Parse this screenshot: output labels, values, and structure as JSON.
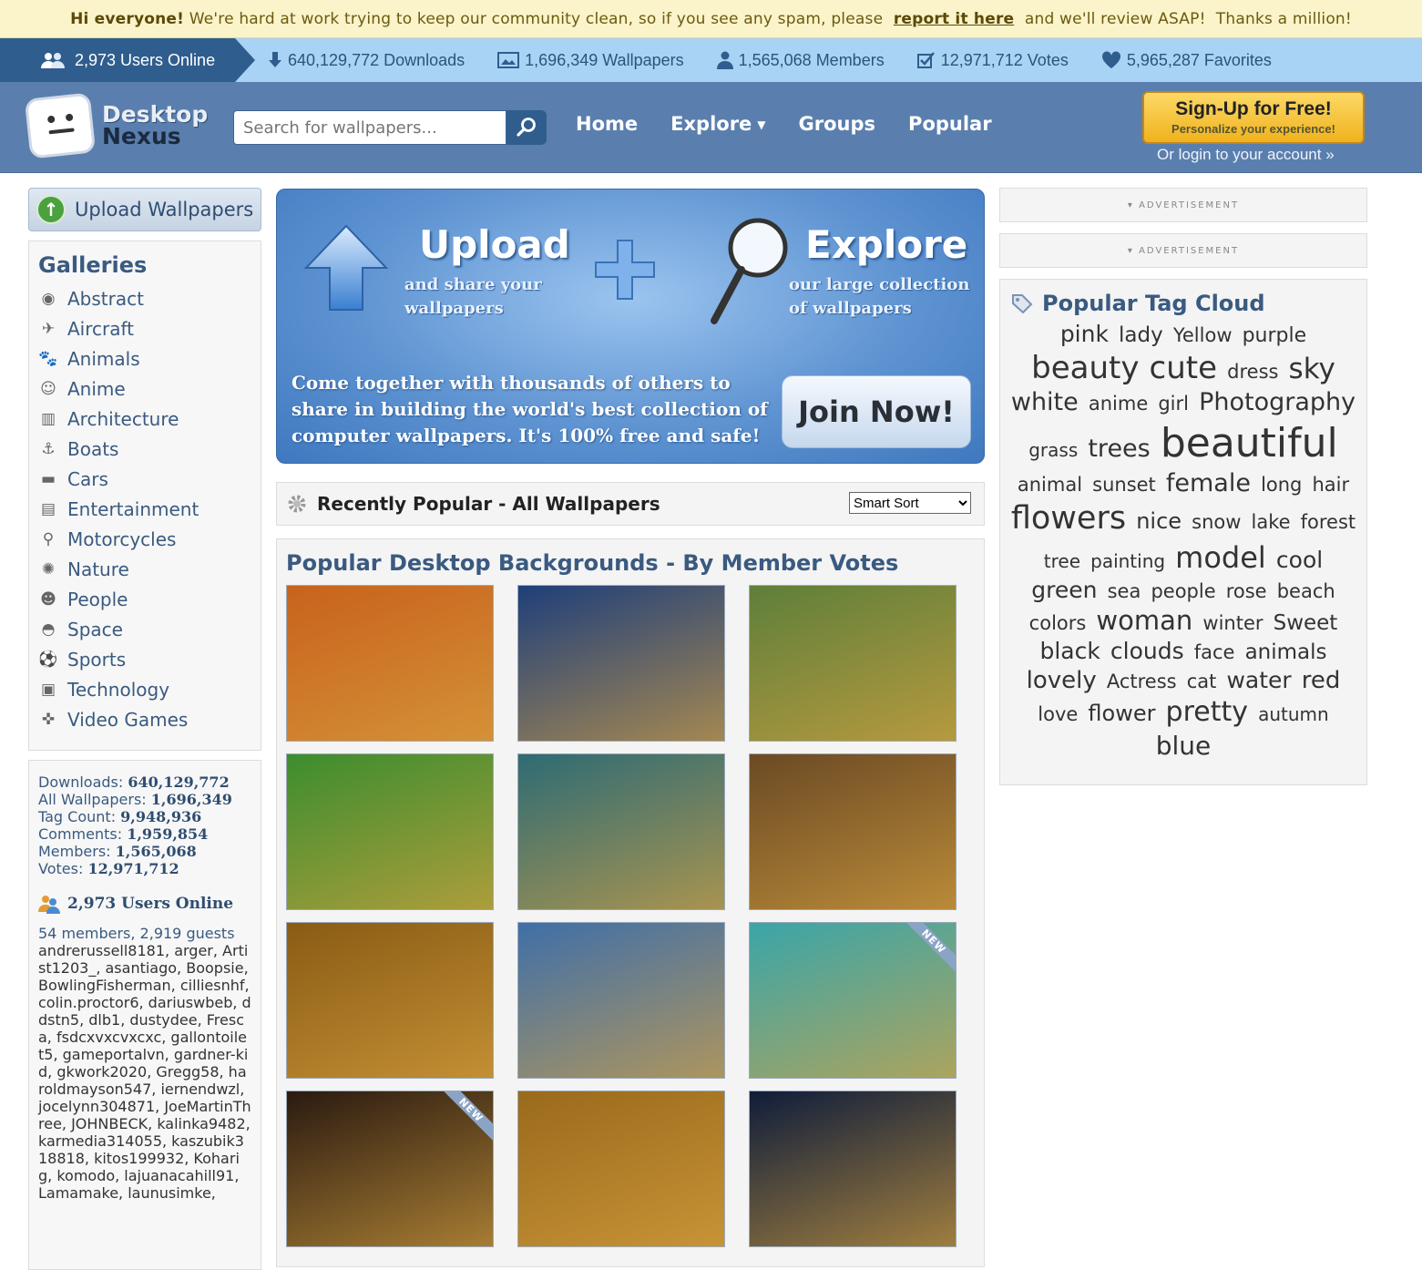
{
  "notice": {
    "greeting": "Hi everyone!",
    "text_before": " We're hard at work trying to keep our community clean, so if you see any spam, please ",
    "link": "report it here",
    "text_after": " and we'll review ASAP!  Thanks a million!"
  },
  "stats": {
    "online": "2,973 Users Online",
    "downloads": "640,129,772 Downloads",
    "wallpapers": "1,696,349 Wallpapers",
    "members": "1,565,068 Members",
    "votes": "12,971,712 Votes",
    "favorites": "5,965,287 Favorites"
  },
  "header": {
    "logo_line1": "Desktop",
    "logo_line2": "Nexus",
    "search_placeholder": "Search for wallpapers...",
    "nav": [
      "Home",
      "Explore",
      "Groups",
      "Popular"
    ],
    "signup_title": "Sign-Up for Free!",
    "signup_sub": "Personalize your experience!",
    "login": "Or login to your account »"
  },
  "left": {
    "upload": "Upload Wallpapers",
    "galleries_title": "Galleries",
    "galleries": [
      {
        "label": "Abstract",
        "icon": "eye-icon",
        "glyph": "◉"
      },
      {
        "label": "Aircraft",
        "icon": "aircraft-icon",
        "glyph": "✈"
      },
      {
        "label": "Animals",
        "icon": "animals-icon",
        "glyph": "🐾"
      },
      {
        "label": "Anime",
        "icon": "anime-icon",
        "glyph": "☺"
      },
      {
        "label": "Architecture",
        "icon": "architecture-icon",
        "glyph": "▥"
      },
      {
        "label": "Boats",
        "icon": "anchor-icon",
        "glyph": "⚓"
      },
      {
        "label": "Cars",
        "icon": "car-icon",
        "glyph": "▬"
      },
      {
        "label": "Entertainment",
        "icon": "film-icon",
        "glyph": "▤"
      },
      {
        "label": "Motorcycles",
        "icon": "motorcycle-icon",
        "glyph": "⚲"
      },
      {
        "label": "Nature",
        "icon": "nature-icon",
        "glyph": "✺"
      },
      {
        "label": "People",
        "icon": "person-icon",
        "glyph": "☻"
      },
      {
        "label": "Space",
        "icon": "ufo-icon",
        "glyph": "◓"
      },
      {
        "label": "Sports",
        "icon": "sports-icon",
        "glyph": "⚽"
      },
      {
        "label": "Technology",
        "icon": "monitor-icon",
        "glyph": "▣"
      },
      {
        "label": "Video Games",
        "icon": "gamepad-icon",
        "glyph": "✜"
      }
    ],
    "site_stats": [
      {
        "label": "Downloads:",
        "value": "640,129,772"
      },
      {
        "label": "All Wallpapers:",
        "value": "1,696,349"
      },
      {
        "label": "Tag Count:",
        "value": "9,948,936"
      },
      {
        "label": "Comments:",
        "value": "1,959,854"
      },
      {
        "label": "Members:",
        "value": "1,565,068"
      },
      {
        "label": "Votes:",
        "value": "12,971,712"
      }
    ],
    "online_head": "2,973 Users Online",
    "member_guest": "54 members, 2,919 guests",
    "online_names": "andrerussell8181, arger, Artist1203_, asantiago, Boopsie, BowlingFisherman, cilliesnhf, colin.proctor6, dariuswbeb, ddstn5, dlb1, dustydee, Fresca, fsdcxvxcvxcxc, gallontoilet5, gameportalvn, gardner-kid, gkwork2020, Gregg58, haroldmayson547, iernendwzl, jocelynn304871, JoeMartinThree, JOHNBECK, kalinka9482, karmedia314055, kaszubik318818, kitos199932, Koharig, komodo, lajuanacahill91, Lamamake, launusimke,"
  },
  "banner": {
    "upload_title": "Upload",
    "upload_sub": "and share your wallpapers",
    "explore_title": "Explore",
    "explore_sub": "our large collection of wallpapers",
    "pitch": "Come together with thousands of others to share in building the world's best collection of computer wallpapers. It's 100% free and safe!",
    "join": "Join Now!"
  },
  "sortbar": {
    "title": "Recently Popular - All Wallpapers",
    "sort_value": "Smart Sort"
  },
  "gallery": {
    "title": "Popular Desktop Backgrounds - By Member Votes",
    "thumbs": [
      {
        "name": "thumb-autumn-pumpkins-basket",
        "bg": "#c8621d",
        "new": false
      },
      {
        "name": "thumb-halloween-witch-night",
        "bg": "#1f3f7a",
        "new": false
      },
      {
        "name": "thumb-mountain-autumn-forest",
        "bg": "#5e7f3a",
        "new": false
      },
      {
        "name": "thumb-trick-or-treat-pumpkin",
        "bg": "#3c8d2e",
        "new": false
      },
      {
        "name": "thumb-lake-reflection",
        "bg": "#2e6b74",
        "new": false
      },
      {
        "name": "thumb-waterfall-autumn",
        "bg": "#6b4a24",
        "new": false
      },
      {
        "name": "thumb-golden-hills",
        "bg": "#8a5b14",
        "new": false
      },
      {
        "name": "thumb-autumn-tree-sky",
        "bg": "#3f6fa8",
        "new": false
      },
      {
        "name": "thumb-coastal-cove",
        "bg": "#3aa5a8",
        "new": true
      },
      {
        "name": "thumb-jack-o-lanterns",
        "bg": "#2a1a10",
        "new": true
      },
      {
        "name": "thumb-autumn-path",
        "bg": "#9a6a1c",
        "new": false
      },
      {
        "name": "thumb-halloween-scarecrow",
        "bg": "#0f1d3a",
        "new": false
      }
    ],
    "new_label": "NEW"
  },
  "right": {
    "ad_label": "▾ ADVERTISEMENT",
    "tag_title": "Popular Tag Cloud",
    "tags": [
      {
        "t": "pink",
        "s": 25
      },
      {
        "t": "lady",
        "s": 23
      },
      {
        "t": "Yellow",
        "s": 21
      },
      {
        "t": "purple",
        "s": 22
      },
      {
        "t": "beauty",
        "s": 34
      },
      {
        "t": "cute",
        "s": 34
      },
      {
        "t": "dress",
        "s": 21
      },
      {
        "t": "sky",
        "s": 31
      },
      {
        "t": "white",
        "s": 27
      },
      {
        "t": "anime",
        "s": 21
      },
      {
        "t": "girl",
        "s": 21
      },
      {
        "t": "Photography",
        "s": 27
      },
      {
        "t": "grass",
        "s": 20
      },
      {
        "t": "trees",
        "s": 27
      },
      {
        "t": "beautiful",
        "s": 44
      },
      {
        "t": "animal",
        "s": 21
      },
      {
        "t": "sunset",
        "s": 21
      },
      {
        "t": "female",
        "s": 27
      },
      {
        "t": "long",
        "s": 21
      },
      {
        "t": "hair",
        "s": 21
      },
      {
        "t": "flowers",
        "s": 35
      },
      {
        "t": "nice",
        "s": 24
      },
      {
        "t": "snow",
        "s": 21
      },
      {
        "t": "lake",
        "s": 21
      },
      {
        "t": "forest",
        "s": 21
      },
      {
        "t": "tree",
        "s": 20
      },
      {
        "t": "painting",
        "s": 20
      },
      {
        "t": "model",
        "s": 32
      },
      {
        "t": "cool",
        "s": 25
      },
      {
        "t": "green",
        "s": 25
      },
      {
        "t": "sea",
        "s": 21
      },
      {
        "t": "people",
        "s": 21
      },
      {
        "t": "rose",
        "s": 21
      },
      {
        "t": "beach",
        "s": 21
      },
      {
        "t": "colors",
        "s": 21
      },
      {
        "t": "woman",
        "s": 29
      },
      {
        "t": "winter",
        "s": 21
      },
      {
        "t": "Sweet",
        "s": 23
      },
      {
        "t": "black",
        "s": 25
      },
      {
        "t": "clouds",
        "s": 25
      },
      {
        "t": "face",
        "s": 21
      },
      {
        "t": "animals",
        "s": 23
      },
      {
        "t": "lovely",
        "s": 26
      },
      {
        "t": "Actress",
        "s": 21
      },
      {
        "t": "cat",
        "s": 21
      },
      {
        "t": "water",
        "s": 25
      },
      {
        "t": "red",
        "s": 26
      },
      {
        "t": "love",
        "s": 21
      },
      {
        "t": "flower",
        "s": 24
      },
      {
        "t": "pretty",
        "s": 30
      },
      {
        "t": "autumn",
        "s": 20
      },
      {
        "t": "blue",
        "s": 28
      }
    ]
  },
  "colors": {
    "header_bg": "#5a7fae",
    "stats_bg": "#a9d3f5",
    "online_tab": "#2f5d8e",
    "accent_text": "#3a5a80"
  }
}
